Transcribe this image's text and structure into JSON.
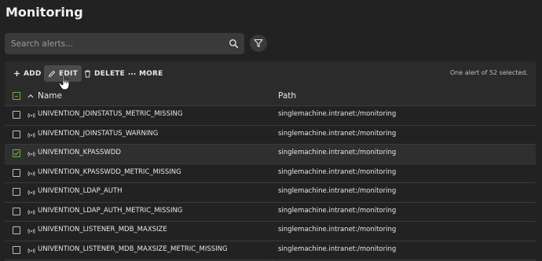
{
  "page": {
    "title": "Monitoring"
  },
  "search": {
    "placeholder": "Search alerts...",
    "value": ""
  },
  "toolbar": {
    "add_label": "ADD",
    "edit_label": "EDIT",
    "delete_label": "DELETE",
    "more_label": "MORE",
    "selection_info": "One alert of 52 selected."
  },
  "table": {
    "columns": {
      "name": "Name",
      "path": "Path"
    },
    "rows": [
      {
        "name": "UNIVENTION_JOINSTATUS_METRIC_MISSING",
        "path": "singlemachine.intranet:/monitoring",
        "checked": false
      },
      {
        "name": "UNIVENTION_JOINSTATUS_WARNING",
        "path": "singlemachine.intranet:/monitoring",
        "checked": false
      },
      {
        "name": "UNIVENTION_KPASSWDD",
        "path": "singlemachine.intranet:/monitoring",
        "checked": true
      },
      {
        "name": "UNIVENTION_KPASSWDD_METRIC_MISSING",
        "path": "singlemachine.intranet:/monitoring",
        "checked": false
      },
      {
        "name": "UNIVENTION_LDAP_AUTH",
        "path": "singlemachine.intranet:/monitoring",
        "checked": false
      },
      {
        "name": "UNIVENTION_LDAP_AUTH_METRIC_MISSING",
        "path": "singlemachine.intranet:/monitoring",
        "checked": false
      },
      {
        "name": "UNIVENTION_LISTENER_MDB_MAXSIZE",
        "path": "singlemachine.intranet:/monitoring",
        "checked": false
      },
      {
        "name": "UNIVENTION_LISTENER_MDB_MAXSIZE_METRIC_MISSING",
        "path": "singlemachine.intranet:/monitoring",
        "checked": false
      }
    ]
  },
  "icons": {
    "search": "search-icon",
    "filter": "filter-icon",
    "add": "plus-icon",
    "edit": "pencil-icon",
    "delete": "trash-icon",
    "more": "ellipsis-icon",
    "sort": "sort-ascending-icon",
    "alert": "signal-icon",
    "cursor": "hand-pointer-icon"
  },
  "colors": {
    "accent": "#6cb33f",
    "background": "#222222",
    "surface": "#2b2b2b"
  }
}
